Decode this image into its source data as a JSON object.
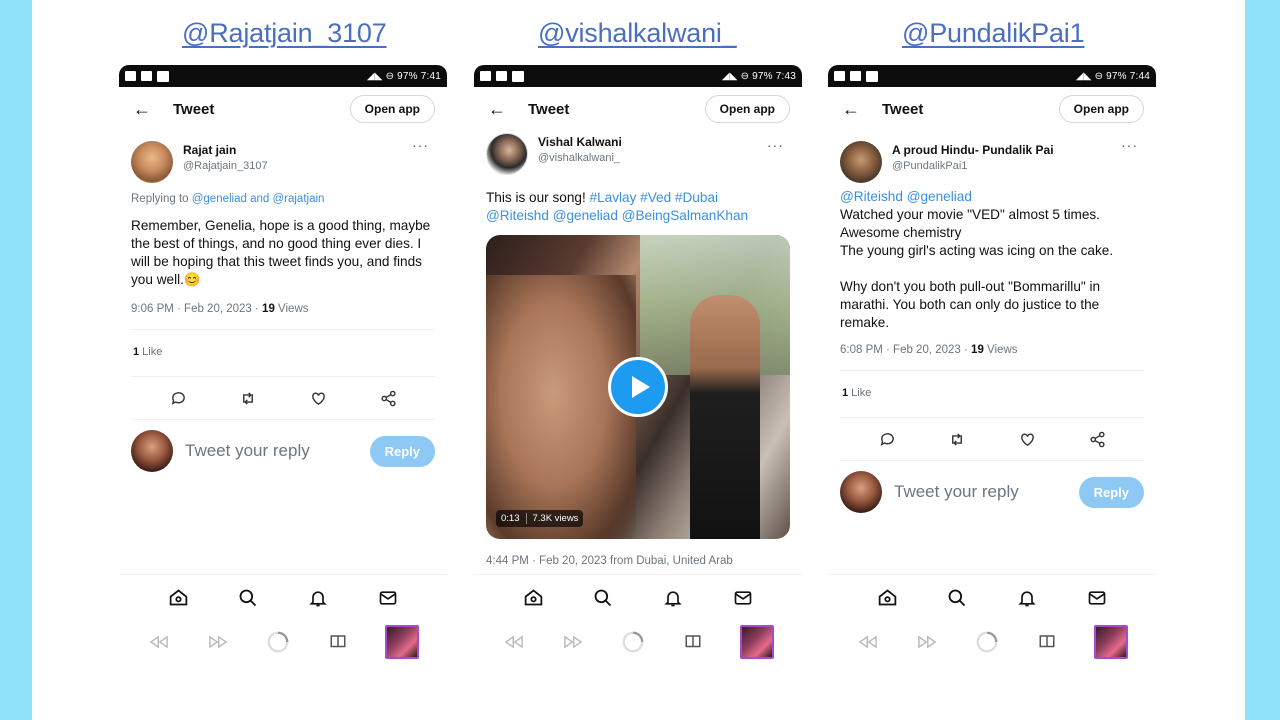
{
  "handles": [
    "@Rajatjain_3107",
    "@vishalkalwani_",
    "@PundalikPai1"
  ],
  "phones": [
    {
      "status": {
        "right": "◢◣ ⊖ 97% 7:41"
      },
      "topbar": {
        "back": "←",
        "title": "Tweet",
        "open_app": "Open app"
      },
      "author": {
        "display_name": "Rajat jain",
        "username": "@Rajatjain_3107",
        "more": "···"
      },
      "replying_prefix": "Replying to ",
      "replying_to": "@geneliad and @rajatjain",
      "body": "Remember, Genelia, hope is a good thing, maybe the best of things, and no good thing ever dies. I will be hoping that this tweet finds you, and finds you well.😊",
      "meta_time": "9:06 PM · Feb 20, 2023 · ",
      "meta_count": "19",
      "meta_label": " Views",
      "likes_count": "1",
      "likes_label": " Like",
      "reply_placeholder": "Tweet your reply",
      "reply_button": "Reply"
    },
    {
      "status": {
        "right": "◢◣ ⊖ 97% 7:43"
      },
      "topbar": {
        "back": "←",
        "title": "Tweet",
        "open_app": "Open app"
      },
      "author": {
        "display_name": "Vishal Kalwani",
        "username": "@vishalkalwani_",
        "more": "···"
      },
      "body_plain": "This is our song! ",
      "body_links_1": "#Lavlay #Ved  #Dubai",
      "body_links_2": "@Riteishd @geneliad @BeingSalmanKhan",
      "video": {
        "duration": "0:13",
        "views": "7.3K views"
      },
      "meta_line": "4:44 PM · Feb 20, 2023 from Dubai, United Arab"
    },
    {
      "status": {
        "right": "◢◣ ⊖ 97% 7:44"
      },
      "topbar": {
        "back": "←",
        "title": "Tweet",
        "open_app": "Open app"
      },
      "author": {
        "display_name": "A proud Hindu- Pundalik Pai",
        "username": "@PundalikPai1",
        "more": "···"
      },
      "mentions": "@Riteishd @geneliad",
      "body_lines": [
        "Watched your movie \"VED\" almost 5 times.",
        "Awesome chemistry",
        "The young girl's acting was icing on the cake.",
        "",
        "Why don't you both pull-out \"Bommarillu\" in marathi. You both can only do justice to the remake."
      ],
      "meta_time": "6:08 PM · Feb 20, 2023 · ",
      "meta_count": "19",
      "meta_label": " Views",
      "likes_count": "1",
      "likes_label": " Like",
      "reply_placeholder": "Tweet your reply",
      "reply_button": "Reply"
    }
  ],
  "colors": {
    "accent": "#1d9bf0",
    "link": "#3b8fe0",
    "handle": "#4a6fc2",
    "reply_disabled": "#8ec8f5",
    "background": "#8fe3f9"
  },
  "icons": {
    "actions": [
      "reply-icon",
      "retweet-icon",
      "like-icon",
      "share-icon"
    ],
    "nav": [
      "home-icon",
      "search-icon",
      "notifications-icon",
      "messages-icon"
    ],
    "media": [
      "rewind-icon",
      "fast-forward-icon",
      "loading-spinner-icon",
      "screen-icon",
      "thumbnail"
    ]
  }
}
